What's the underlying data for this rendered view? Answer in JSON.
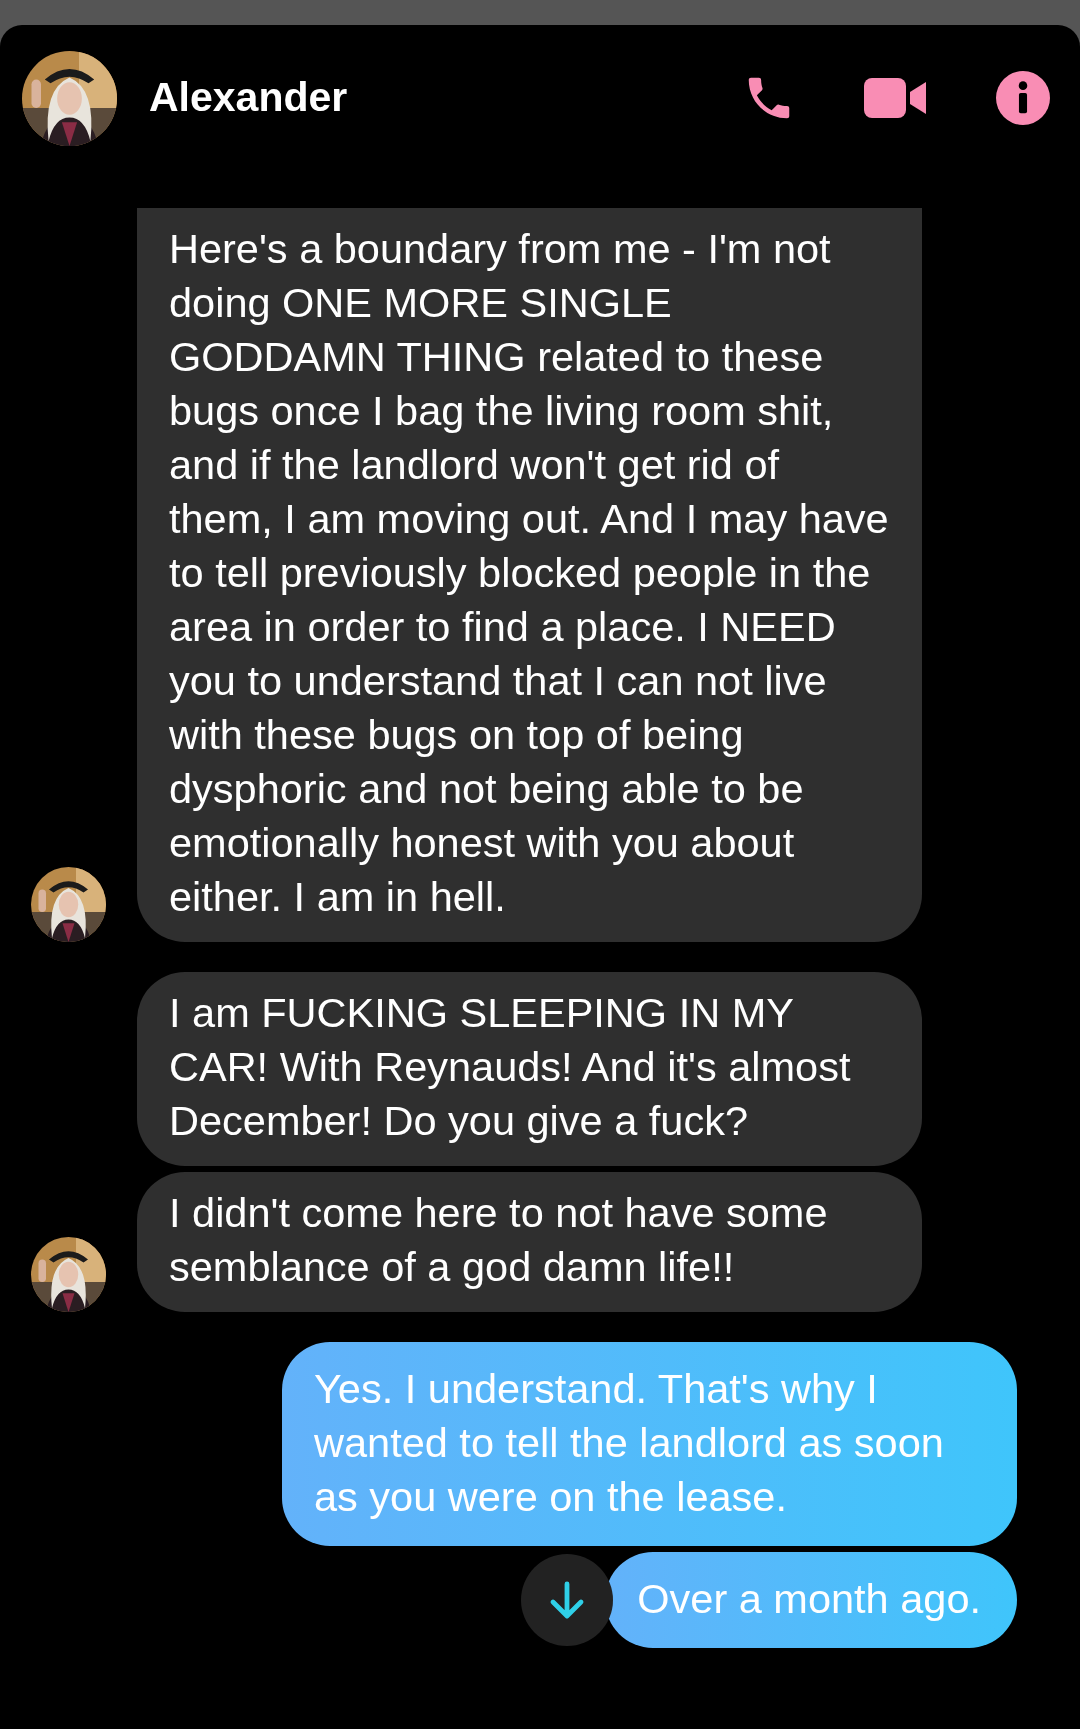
{
  "contact": {
    "name": "Alexander"
  },
  "header_actions": [
    {
      "kind": "call"
    },
    {
      "kind": "video"
    },
    {
      "kind": "info"
    }
  ],
  "messages": [
    {
      "kind": "incoming",
      "show_avatar": true,
      "text": "Here's a boundary from me - I'm not doing ONE MORE SINGLE GODDAMN THING related to these bugs once I bag the living room shit, and if the landlord won't get rid of them, I am moving out. And I may have to tell previously blocked people in the area in order to find a place. I NEED you to understand that I can not live with these bugs on top of being dysphoric and not being able to be emotionally honest with you about either. I am in hell."
    },
    {
      "kind": "incoming",
      "show_avatar": false,
      "text": "I am FUCKING SLEEPING IN MY CAR! With Reynauds! And it's almost December! Do you give a fuck?"
    },
    {
      "kind": "incoming",
      "show_avatar": true,
      "text": "I didn't come here to not have some semblance of a god damn life!!"
    },
    {
      "kind": "outgoing",
      "text": "Yes. I understand. That's why I wanted to tell the landlord as soon as you were on the lease."
    },
    {
      "kind": "outgoing",
      "text": "Over a month ago."
    }
  ]
}
